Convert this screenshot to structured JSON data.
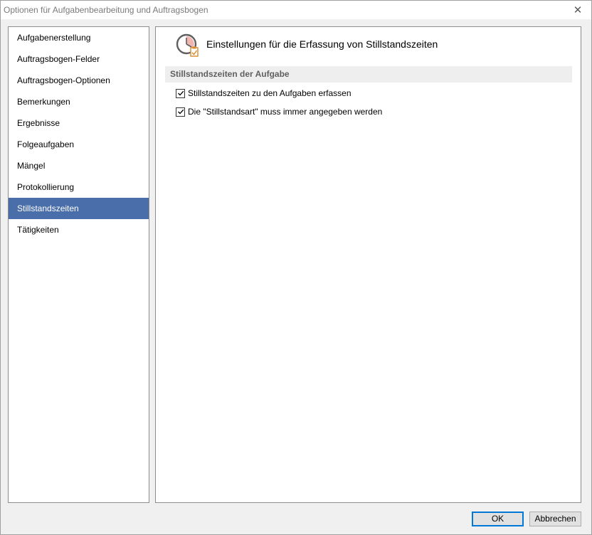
{
  "window": {
    "title": "Optionen für Aufgabenbearbeitung und Auftragsbogen",
    "close_glyph": "✕"
  },
  "sidebar": {
    "items": [
      {
        "label": "Aufgabenerstellung",
        "selected": false
      },
      {
        "label": "Auftragsbogen-Felder",
        "selected": false
      },
      {
        "label": "Auftragsbogen-Optionen",
        "selected": false
      },
      {
        "label": "Bemerkungen",
        "selected": false
      },
      {
        "label": "Ergebnisse",
        "selected": false
      },
      {
        "label": "Folgeaufgaben",
        "selected": false
      },
      {
        "label": "Mängel",
        "selected": false
      },
      {
        "label": "Protokollierung",
        "selected": false
      },
      {
        "label": "Stillstandszeiten",
        "selected": true
      },
      {
        "label": "Tätigkeiten",
        "selected": false
      }
    ]
  },
  "main": {
    "header_icon": "clock-checklist-icon",
    "header_title": "Einstellungen für die Erfassung von Stillstandszeiten",
    "section_title": "Stillstandszeiten der Aufgabe",
    "options": [
      {
        "label": "Stillstandszeiten zu den Aufgaben erfassen",
        "checked": true
      },
      {
        "label": "Die \"Stillstandsart\" muss immer angegeben werden",
        "checked": true
      }
    ]
  },
  "buttons": {
    "ok": "OK",
    "cancel": "Abbrechen"
  },
  "colors": {
    "selection": "#4a6ea9",
    "default_button_border": "#0078d7",
    "section_band": "#eeeeee"
  }
}
